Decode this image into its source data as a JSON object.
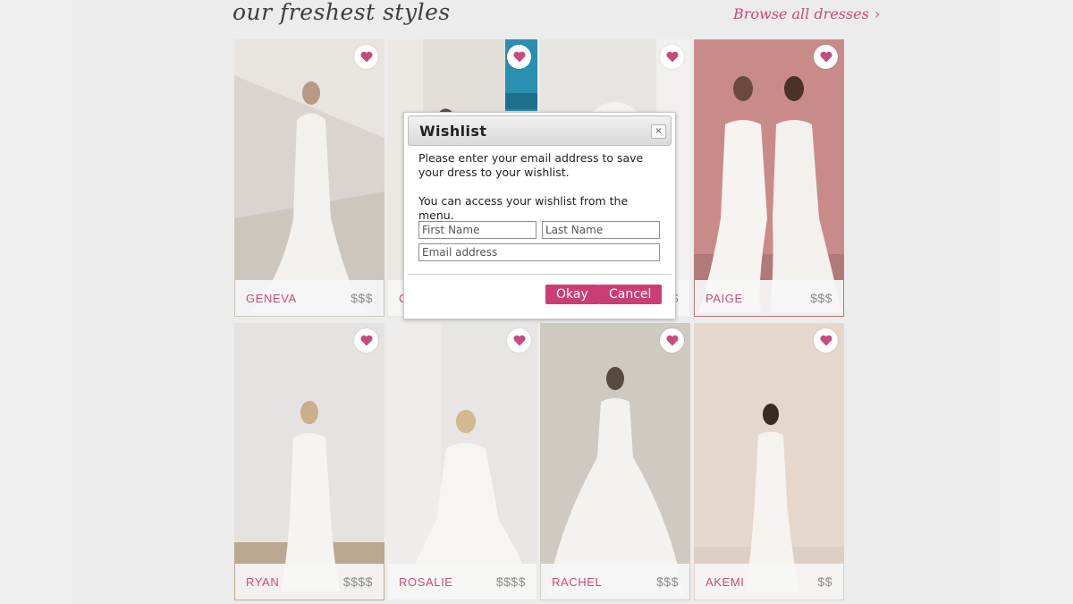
{
  "section_title": "our freshest styles",
  "browse": {
    "label": "Browse all dresses",
    "chevron": "›"
  },
  "colors": {
    "accent": "#c74b7e",
    "button": "#cc3d74"
  },
  "dresses": [
    {
      "name": "GENEVA",
      "price": "$$$"
    },
    {
      "name": "C",
      "price": ""
    },
    {
      "name": "",
      "price": "$"
    },
    {
      "name": "PAIGE",
      "price": "$$$"
    },
    {
      "name": "RYAN",
      "price": "$$$$"
    },
    {
      "name": "ROSALIE",
      "price": "$$$$"
    },
    {
      "name": "RACHEL",
      "price": "$$$"
    },
    {
      "name": "AKEMI",
      "price": "$$"
    }
  ],
  "dialog": {
    "title": "Wishlist",
    "close_icon": "×",
    "message": "Please enter your email address to save your dress to your wishlist.",
    "message2": "You can access your wishlist from the menu.",
    "first_name_placeholder": "First Name",
    "last_name_placeholder": "Last Name",
    "email_placeholder": "Email address",
    "okay_label": "Okay",
    "cancel_label": "Cancel"
  },
  "icons": {
    "heart": "heart-icon",
    "close": "close-icon",
    "chevron": "chevron-right-icon"
  }
}
